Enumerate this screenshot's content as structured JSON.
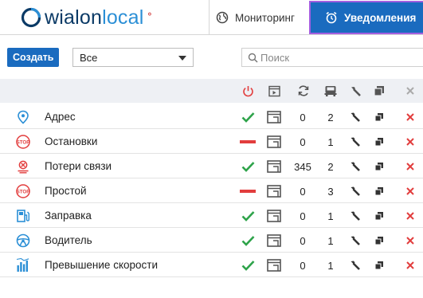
{
  "header": {
    "logo_part1": "wialon",
    "logo_part2": "local",
    "nav": [
      {
        "label": "Мониторинг",
        "icon": "globe-icon"
      },
      {
        "label": "Уведомления",
        "icon": "alarm-clock-icon",
        "active": true
      }
    ]
  },
  "toolbar": {
    "create_label": "Создать",
    "filter_value": "Все",
    "search_placeholder": "Поиск"
  },
  "columns": [
    {
      "icon": "power-icon"
    },
    {
      "icon": "calendar-icon"
    },
    {
      "icon": "refresh-icon"
    },
    {
      "icon": "vehicle-icon"
    },
    {
      "icon": "wrench-icon"
    },
    {
      "icon": "copy-icon"
    },
    {
      "icon": "delete-icon"
    }
  ],
  "rows": [
    {
      "name": "Адрес",
      "icon": "location-icon",
      "enabled": true,
      "triggers": "0",
      "units": "2"
    },
    {
      "name": "Остановки",
      "icon": "stop-sign-icon",
      "enabled": false,
      "triggers": "0",
      "units": "1"
    },
    {
      "name": "Потери связи",
      "icon": "connection-loss-icon",
      "enabled": true,
      "triggers": "345",
      "units": "2"
    },
    {
      "name": "Простой",
      "icon": "stop-sign-icon",
      "enabled": false,
      "triggers": "0",
      "units": "3"
    },
    {
      "name": "Заправка",
      "icon": "fuel-station-icon",
      "enabled": true,
      "triggers": "0",
      "units": "1"
    },
    {
      "name": "Водитель",
      "icon": "steering-wheel-icon",
      "enabled": true,
      "triggers": "0",
      "units": "1"
    },
    {
      "name": "Превышение скорости",
      "icon": "speed-bars-icon",
      "enabled": true,
      "triggers": "0",
      "units": "1"
    }
  ],
  "colors": {
    "accent": "#1a6bbf",
    "enabled_check": "#2ea34a",
    "disabled_dash": "#e23d3d",
    "delete": "#e23d3d",
    "active_tab_outline": "#a35ee0"
  }
}
